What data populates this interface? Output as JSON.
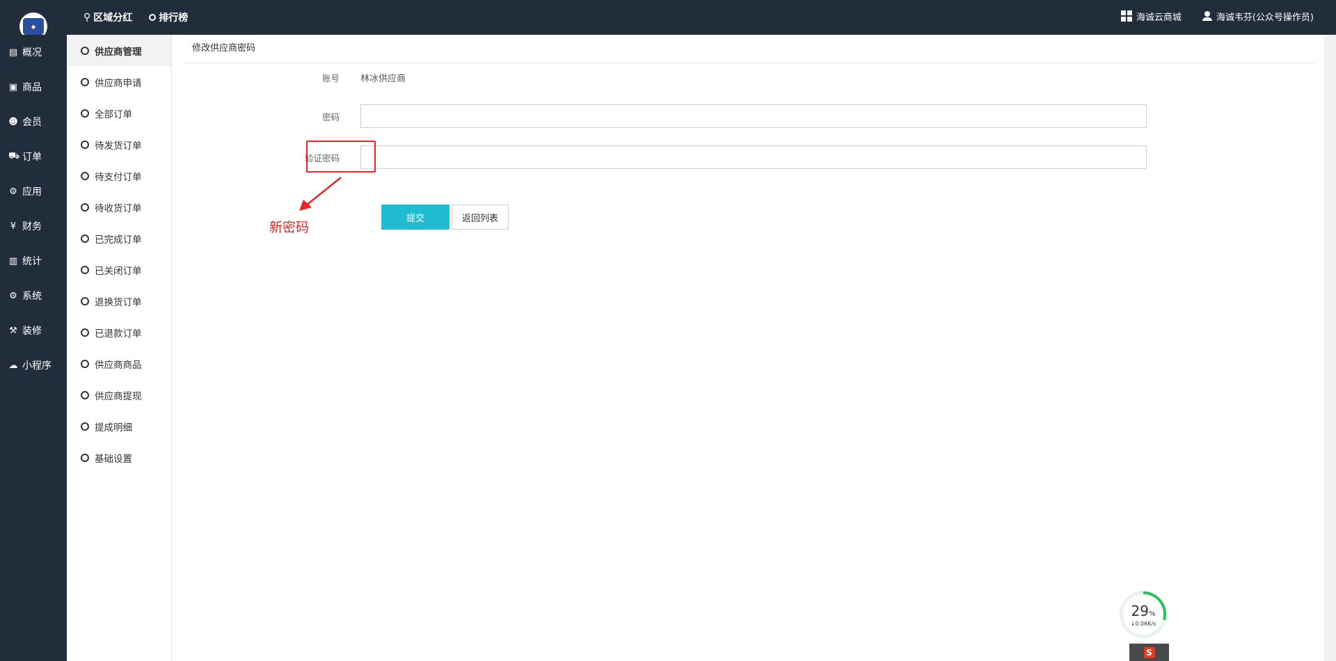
{
  "topbar": {
    "nav": [
      {
        "icon": "pin-icon",
        "label": "区域分红"
      },
      {
        "icon": "circle-icon",
        "label": "排行榜"
      }
    ],
    "right": [
      {
        "icon": "grid-icon",
        "label": "海诚云商城"
      },
      {
        "icon": "user-icon",
        "label": "海诚韦芬(公众号操作员)"
      }
    ]
  },
  "sidebar": {
    "items": [
      {
        "icon": "overview-icon",
        "label": "概况"
      },
      {
        "icon": "box-icon",
        "label": "商品"
      },
      {
        "icon": "users-icon",
        "label": "会员"
      },
      {
        "icon": "cart-icon",
        "label": "订单"
      },
      {
        "icon": "apps-icon",
        "label": "应用"
      },
      {
        "icon": "yen-icon",
        "label": "财务"
      },
      {
        "icon": "bar-chart-icon",
        "label": "统计"
      },
      {
        "icon": "gears-icon",
        "label": "系统"
      },
      {
        "icon": "hammer-icon",
        "label": "装修"
      },
      {
        "icon": "wechat-icon",
        "label": "小程序"
      }
    ]
  },
  "submenu": {
    "items": [
      {
        "label": "供应商管理",
        "active": true
      },
      {
        "label": "供应商申请"
      },
      {
        "label": "全部订单"
      },
      {
        "label": "待发货订单"
      },
      {
        "label": "待支付订单"
      },
      {
        "label": "待收货订单"
      },
      {
        "label": "已完成订单"
      },
      {
        "label": "已关闭订单"
      },
      {
        "label": "退换货订单"
      },
      {
        "label": "已退款订单"
      },
      {
        "label": "供应商商品"
      },
      {
        "label": "供应商提现"
      },
      {
        "label": "提成明细"
      },
      {
        "label": "基础设置"
      }
    ]
  },
  "page": {
    "title": "修改供应商密码",
    "form": {
      "account_label": "账号",
      "account_value": "林冰供应商",
      "password_label": "密码",
      "password_value": "",
      "confirm_label": "验证密码",
      "confirm_value": ""
    },
    "buttons": {
      "submit": "提交",
      "back": "返回列表"
    },
    "annotation": "新密码"
  },
  "net_widget": {
    "percent": "29",
    "percent_unit": "%",
    "speed": "0.06K/s"
  },
  "ime": {
    "label": "S"
  },
  "colors": {
    "dark": "#222d3c",
    "accent": "#1fbcd2",
    "annotation": "#e82323"
  }
}
